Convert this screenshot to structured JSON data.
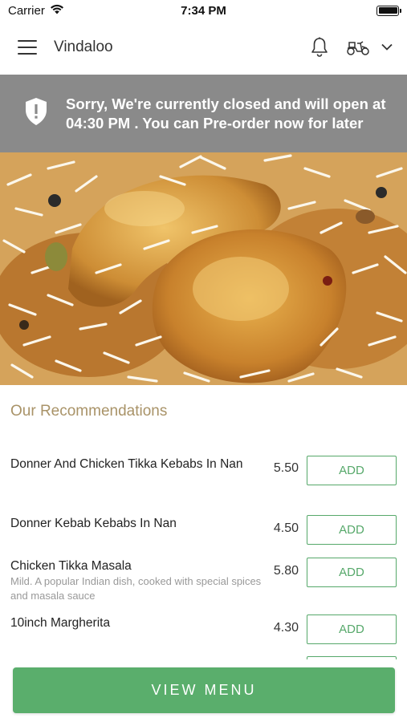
{
  "status_bar": {
    "carrier": "Carrier",
    "time": "7:34 PM"
  },
  "header": {
    "title": "Vindaloo"
  },
  "banner": {
    "message": "Sorry, We're currently closed and will open at 04:30 PM . You can Pre-order now for later"
  },
  "recommendations": {
    "title": "Our Recommendations",
    "items": [
      {
        "name": "Donner And Chicken Tikka Kebabs In Nan",
        "description": "",
        "price": "5.50",
        "add_label": "ADD"
      },
      {
        "name": "Donner Kebab Kebabs In Nan",
        "description": "",
        "price": "4.50",
        "add_label": "ADD"
      },
      {
        "name": "Chicken Tikka Masala",
        "description": "Mild. A popular Indian dish, cooked with special spices and masala sauce",
        "price": "5.80",
        "add_label": "ADD"
      },
      {
        "name": "10inch Margherita",
        "description": "",
        "price": "4.30",
        "add_label": "ADD"
      }
    ]
  },
  "footer": {
    "view_menu_label": "VIEW MENU"
  },
  "colors": {
    "accent_green": "#5aae6c",
    "banner_gray": "#8a8a8a",
    "section_title": "#a99368"
  }
}
